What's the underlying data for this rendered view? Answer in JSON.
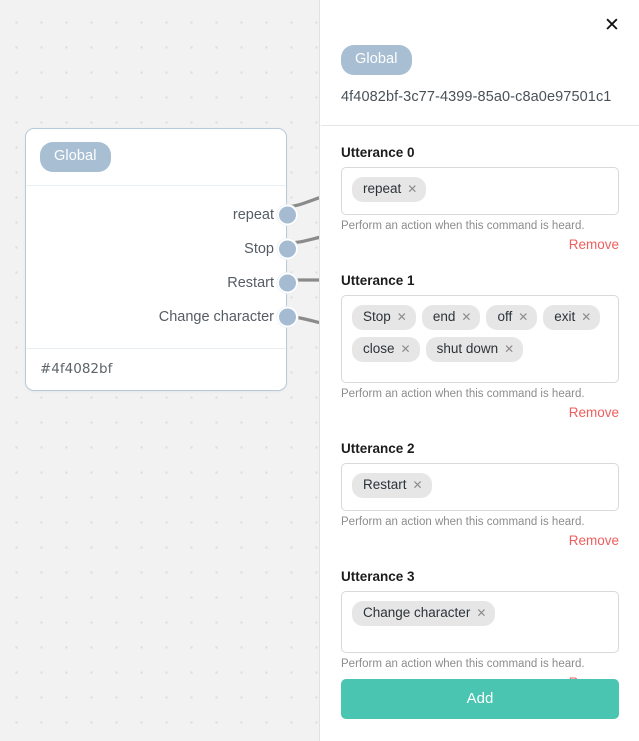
{
  "canvas": {
    "node": {
      "badge": "Global",
      "ports": [
        {
          "label": "repeat"
        },
        {
          "label": "Stop"
        },
        {
          "label": "Restart"
        },
        {
          "label": "Change character"
        }
      ],
      "footer_id": "#4f4082bf"
    }
  },
  "panel": {
    "close_label": "✕",
    "badge": "Global",
    "id": "4f4082bf-3c77-4399-85a0-c8a0e97501c1",
    "helper_text": "Perform an action when this command is heard.",
    "remove_label": "Remove",
    "add_label": "Add",
    "utterances": [
      {
        "title": "Utterance 0",
        "size": "h-sm",
        "tags": [
          "repeat"
        ]
      },
      {
        "title": "Utterance 1",
        "size": "h-lg",
        "tags": [
          "Stop",
          "end",
          "off",
          "exit",
          "close",
          "shut down"
        ]
      },
      {
        "title": "Utterance 2",
        "size": "h-sm",
        "tags": [
          "Restart"
        ]
      },
      {
        "title": "Utterance 3",
        "size": "h-md",
        "tags": [
          "Change character"
        ]
      }
    ]
  },
  "colors": {
    "badge": "#a8bed3",
    "port": "#a4bbd1",
    "accent_add": "#49c5b1",
    "remove": "#ef5e5e",
    "canvas_bg": "#f2f2f2"
  }
}
